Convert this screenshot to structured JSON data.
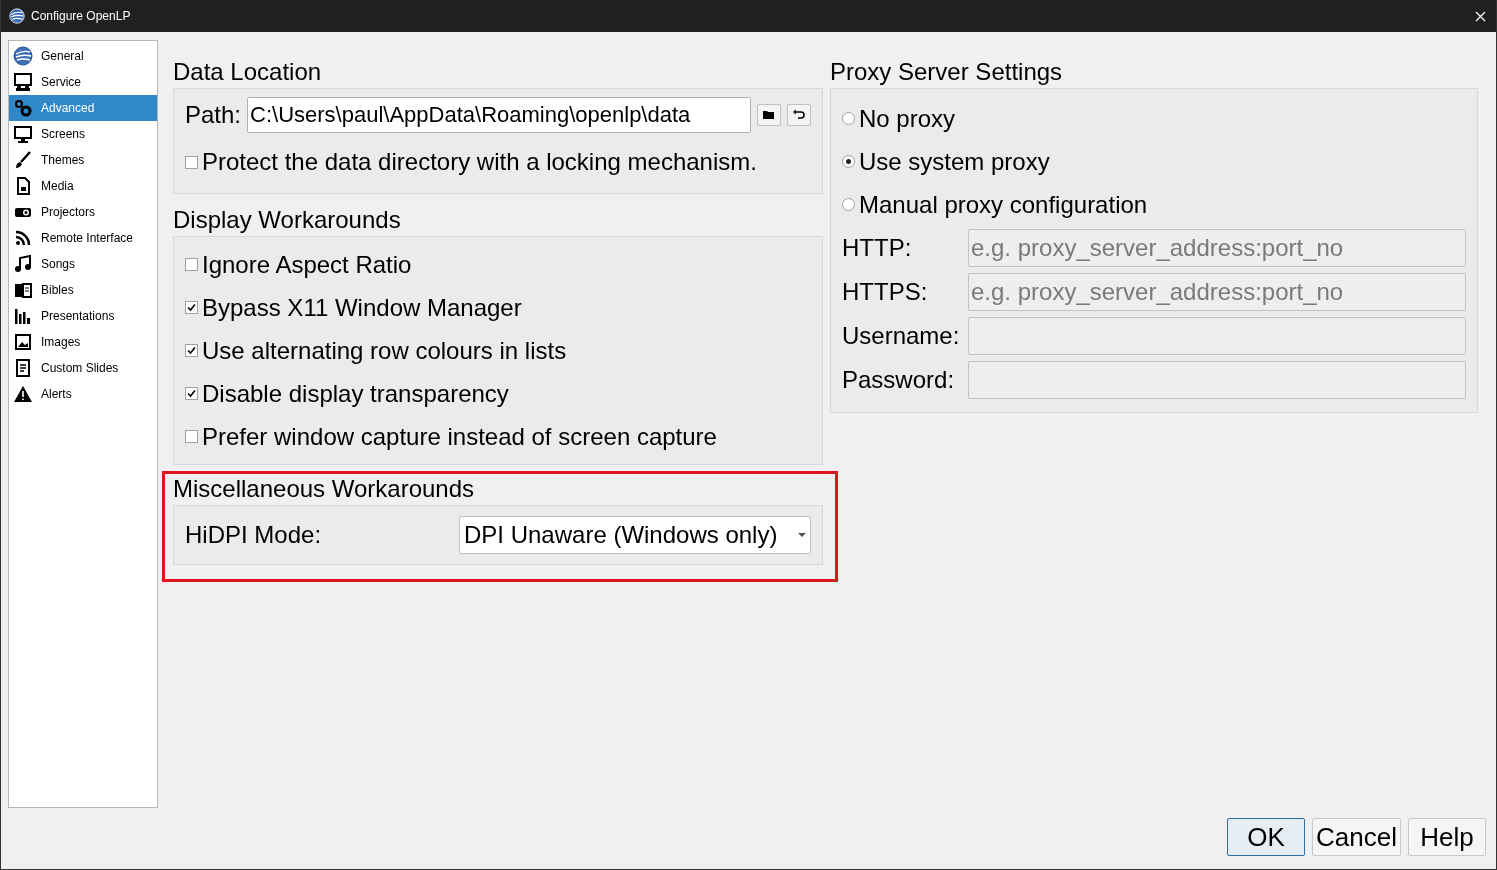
{
  "window": {
    "title": "Configure OpenLP"
  },
  "sidebar": {
    "items": [
      {
        "label": "General",
        "selected": false
      },
      {
        "label": "Service",
        "selected": false
      },
      {
        "label": "Advanced",
        "selected": true
      },
      {
        "label": "Screens",
        "selected": false
      },
      {
        "label": "Themes",
        "selected": false
      },
      {
        "label": "Media",
        "selected": false
      },
      {
        "label": "Projectors",
        "selected": false
      },
      {
        "label": "Remote Interface",
        "selected": false
      },
      {
        "label": "Songs",
        "selected": false
      },
      {
        "label": "Bibles",
        "selected": false
      },
      {
        "label": "Presentations",
        "selected": false
      },
      {
        "label": "Images",
        "selected": false
      },
      {
        "label": "Custom Slides",
        "selected": false
      },
      {
        "label": "Alerts",
        "selected": false
      }
    ]
  },
  "data_location": {
    "heading": "Data Location",
    "path_label": "Path:",
    "path_value": "C:\\Users\\paul\\AppData\\Roaming\\openlp\\data",
    "protect": {
      "label": "Protect the data directory with a locking mechanism.",
      "checked": false
    }
  },
  "display_workarounds": {
    "heading": "Display Workarounds",
    "options": [
      {
        "label": "Ignore Aspect Ratio",
        "checked": false
      },
      {
        "label": "Bypass X11 Window Manager",
        "checked": true
      },
      {
        "label": "Use alternating row colours in lists",
        "checked": true
      },
      {
        "label": "Disable display transparency",
        "checked": true
      },
      {
        "label": "Prefer window capture instead of screen capture",
        "checked": false
      }
    ]
  },
  "misc_workarounds": {
    "heading": "Miscellaneous Workarounds",
    "highlighted": true,
    "hidpi_label": "HiDPI Mode:",
    "hidpi_value": "DPI Unaware (Windows only)"
  },
  "proxy": {
    "heading": "Proxy Server Settings",
    "options": [
      {
        "label": "No proxy",
        "selected": false
      },
      {
        "label": "Use system proxy",
        "selected": true
      },
      {
        "label": "Manual proxy configuration",
        "selected": false
      }
    ],
    "fields": [
      {
        "label": "HTTP:",
        "placeholder": "e.g. proxy_server_address:port_no",
        "disabled": true
      },
      {
        "label": "HTTPS:",
        "placeholder": "e.g. proxy_server_address:port_no",
        "disabled": true
      },
      {
        "label": "Username:",
        "disabled": true
      },
      {
        "label": "Password:",
        "disabled": true
      }
    ]
  },
  "buttons": [
    {
      "label": "OK",
      "default": true
    },
    {
      "label": "Cancel",
      "default": false
    },
    {
      "label": "Help",
      "default": false
    }
  ]
}
